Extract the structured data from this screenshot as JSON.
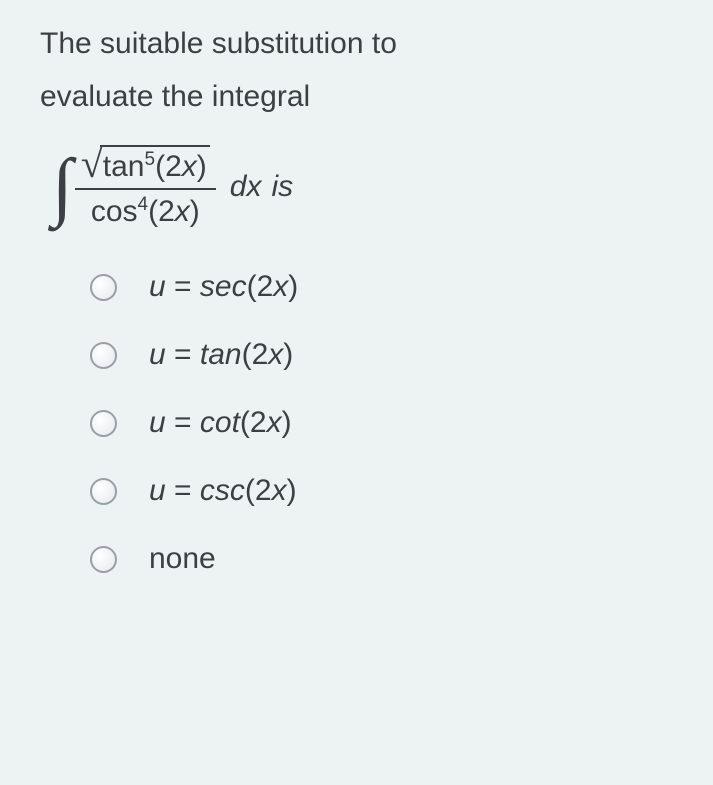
{
  "question": {
    "line1": "The suitable substitution to",
    "line2": "evaluate the integral",
    "func_numerator": "tan",
    "exp_numerator": "5",
    "arg": "(2x)",
    "func_denominator": "cos",
    "exp_denominator": "4",
    "dx": "dx",
    "suffix": "is"
  },
  "options": [
    {
      "var": "u",
      "eq": " =  ",
      "func": "sec",
      "arg": "(2x)"
    },
    {
      "var": "u",
      "eq": " = ",
      "func": "tan",
      "arg": "(2x)"
    },
    {
      "var": "u",
      "eq": " = ",
      "func": "cot",
      "arg": "(2x)"
    },
    {
      "var": "u",
      "eq": " = ",
      "func": "csc",
      "arg": "(2x)"
    }
  ],
  "option_none": "none"
}
